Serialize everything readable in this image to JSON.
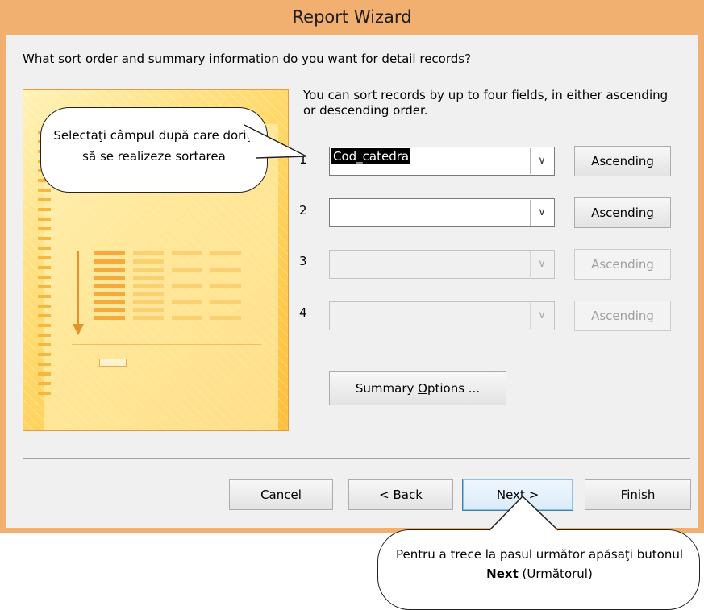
{
  "window": {
    "title": "Report Wizard"
  },
  "question": "What sort order and summary information do you want for detail records?",
  "hint": "You can sort records by up to four fields, in either ascending or descending order.",
  "sort_rows": [
    {
      "num": "1",
      "value": "Cod_catedra",
      "order": "Ascending",
      "enabled": true
    },
    {
      "num": "2",
      "value": "",
      "order": "Ascending",
      "enabled": true
    },
    {
      "num": "3",
      "value": "",
      "order": "Ascending",
      "enabled": false
    },
    {
      "num": "4",
      "value": "",
      "order": "Ascending",
      "enabled": false
    }
  ],
  "dropdown_icon": "chevron-down-icon",
  "summary_button": {
    "label_pre": "Summary ",
    "label_mnemonic": "O",
    "label_post": "ptions ..."
  },
  "footer": {
    "cancel": "Cancel",
    "back_pre": "< ",
    "back_mnemonic": "B",
    "back_post": "ack",
    "next_mnemonic": "N",
    "next_post": "ext >",
    "finish_mnemonic": "F",
    "finish_post": "inish"
  },
  "callouts": {
    "sort_field": "Selectaţi câmpul după care doriţi să se realizeze sortarea",
    "next_pre": "Pentru a trece la pasul următor apăsaţi butonul ",
    "next_bold": "Next",
    "next_post": " (Următorul)"
  },
  "colors": {
    "frame": "#f2b070",
    "client": "#f0f0f0",
    "default_button_border": "#3c7fb1"
  }
}
